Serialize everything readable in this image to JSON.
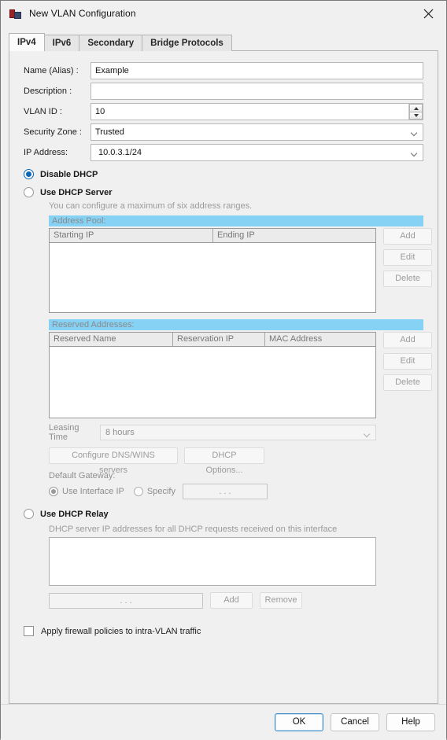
{
  "window": {
    "title": "New VLAN Configuration",
    "app_icon": "vlan-app-icon",
    "close_icon": "close-icon"
  },
  "tabs": [
    {
      "label": "IPv4",
      "active": true
    },
    {
      "label": "IPv6",
      "active": false
    },
    {
      "label": "Secondary",
      "active": false
    },
    {
      "label": "Bridge Protocols",
      "active": false
    }
  ],
  "form": {
    "name": {
      "label": "Name (Alias) :",
      "value": "Example",
      "placeholder": ""
    },
    "description": {
      "label": "Description :",
      "value": "",
      "placeholder": ""
    },
    "vlan_id": {
      "label": "VLAN ID :",
      "value": "10"
    },
    "security_zone": {
      "label": "Security Zone :",
      "value": "Trusted"
    },
    "ip_address": {
      "label": "IP Address:",
      "value": "10.0.3.1/24"
    }
  },
  "dhcp_mode": {
    "disable": {
      "label": "Disable DHCP",
      "selected": true
    },
    "server": {
      "label": "Use DHCP Server",
      "selected": false
    },
    "relay": {
      "label": "Use DHCP Relay",
      "selected": false
    }
  },
  "dhcp_server": {
    "hint": "You can configure a maximum of six address ranges.",
    "address_pool": {
      "band_label": "Address Pool:",
      "columns": [
        "Starting IP",
        "Ending IP"
      ],
      "rows": [],
      "buttons": [
        "Add",
        "Edit",
        "Delete"
      ]
    },
    "reserved": {
      "band_label": "Reserved Addresses:",
      "columns": [
        "Reserved Name",
        "Reservation IP",
        "MAC Address"
      ],
      "rows": [],
      "buttons": [
        "Add",
        "Edit",
        "Delete"
      ]
    },
    "leasing_time": {
      "label": "Leasing Time",
      "value": "8 hours"
    },
    "dns_wins_button": "Configure DNS/WINS servers",
    "dhcp_options_button": "DHCP Options...",
    "default_gateway": {
      "label": "Default Gateway:",
      "use_interface_ip": {
        "label": "Use Interface IP",
        "selected": true
      },
      "specify": {
        "label": "Specify",
        "selected": false
      },
      "ip_value": ".   .   ."
    }
  },
  "dhcp_relay": {
    "hint": "DHCP server IP addresses for all DHCP requests received on this interface",
    "entries": [],
    "ip_value": ".   .   .",
    "add_button": "Add",
    "remove_button": "Remove"
  },
  "intra_vlan": {
    "label": "Apply firewall policies to intra-VLAN traffic",
    "checked": false
  },
  "footer": {
    "ok": "OK",
    "cancel": "Cancel",
    "help": "Help"
  },
  "colors": {
    "band": "#85d2f5",
    "radio_accent": "#0b67b3",
    "primary_border": "#3d8ecb"
  }
}
